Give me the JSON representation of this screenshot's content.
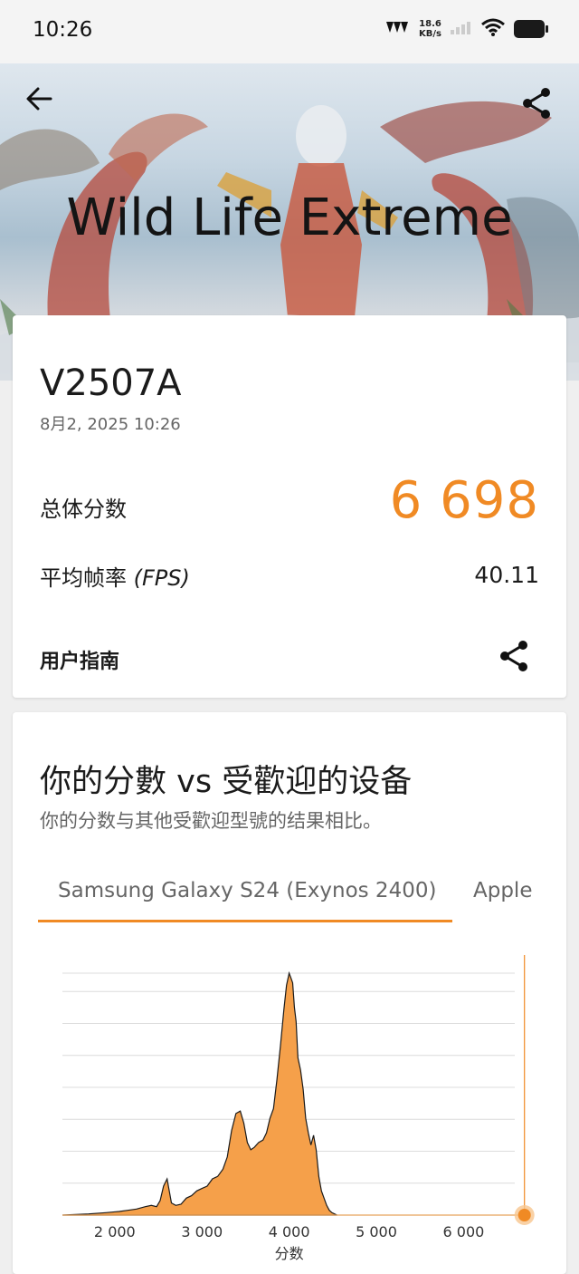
{
  "status_bar": {
    "time": "10:26",
    "net_speed_value": "18.6",
    "net_speed_unit": "KB/s"
  },
  "hero": {
    "title": "Wild Life Extreme"
  },
  "result": {
    "device": "V2507A",
    "date": "8月2, 2025 10:26",
    "overall_label": "总体分数",
    "overall_score": "6 698",
    "fps_label": "平均帧率",
    "fps_unit": "(FPS)",
    "fps_value": "40.11",
    "guide_label": "用户指南"
  },
  "comparison": {
    "title": "你的分數 vs 受歡迎的设备",
    "subtitle": "你的分数与其他受歡迎型號的结果相比。",
    "tabs": [
      {
        "label": "Samsung Galaxy S24 (Exynos 2400)",
        "active": true
      },
      {
        "label": "Apple",
        "active": false
      }
    ]
  },
  "colors": {
    "accent": "#f08a24",
    "fill": "#f5a04a"
  },
  "chart_data": {
    "type": "area",
    "xlabel": "分数",
    "x_ticks": [
      "2 000",
      "3 000",
      "4 000",
      "5 000",
      "6 000"
    ],
    "xlim": [
      1400,
      6950
    ],
    "ylim": [
      0,
      100
    ],
    "grid": true,
    "marker_score": 6698,
    "x": [
      1400,
      1700,
      1900,
      2050,
      2150,
      2250,
      2350,
      2420,
      2480,
      2520,
      2560,
      2600,
      2650,
      2700,
      2760,
      2820,
      2880,
      2940,
      3000,
      3060,
      3120,
      3180,
      3240,
      3290,
      3340,
      3390,
      3440,
      3480,
      3520,
      3560,
      3600,
      3650,
      3700,
      3740,
      3780,
      3820,
      3860,
      3900,
      3940,
      3970,
      4000,
      4020,
      4040,
      4060,
      4080,
      4100,
      4130,
      4160,
      4190,
      4220,
      4250,
      4280,
      4310,
      4340,
      4370,
      4400,
      4430,
      4460,
      4490,
      4550
    ],
    "y": [
      0,
      0.5,
      1,
      1.5,
      2,
      2.5,
      3.5,
      4,
      3.5,
      6,
      12,
      15,
      5,
      4,
      4.5,
      7,
      8,
      10,
      11,
      12,
      15,
      16,
      19,
      24,
      35,
      42,
      43,
      38,
      30,
      27,
      28,
      30,
      31,
      34,
      40,
      44,
      56,
      70,
      85,
      95,
      100,
      98,
      96,
      86,
      80,
      65,
      60,
      52,
      40,
      34,
      29,
      33,
      27,
      16,
      10,
      7,
      4,
      2,
      1,
      0
    ],
    "grid_lines": [
      0,
      13.2,
      26.4,
      39.6,
      52.8,
      66,
      79.2,
      92.4,
      100
    ]
  }
}
